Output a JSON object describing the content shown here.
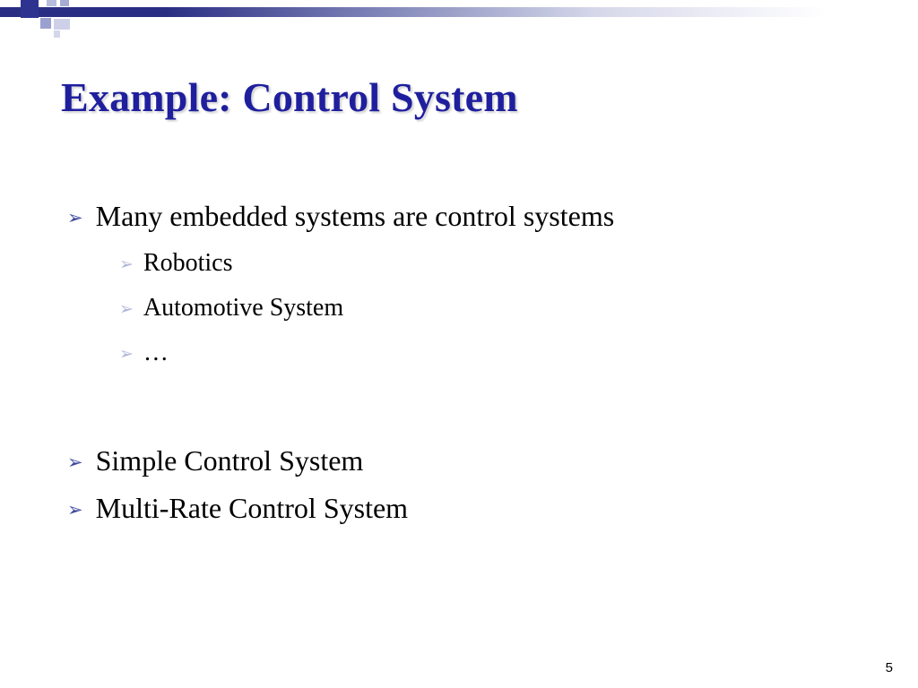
{
  "slide": {
    "title": "Example: Control System",
    "bullets_top": {
      "main": "Many embedded systems are control systems",
      "sub": [
        "Robotics",
        "Automotive System",
        "…"
      ]
    },
    "bullets_bottom": [
      "Simple Control System",
      "Multi-Rate Control System"
    ],
    "page_number": "5"
  },
  "glyphs": {
    "tri": "➢"
  },
  "colors": {
    "title": "#1f1f9e",
    "bullet1": "#3d4a9e",
    "bullet2": "#b1b7da"
  }
}
